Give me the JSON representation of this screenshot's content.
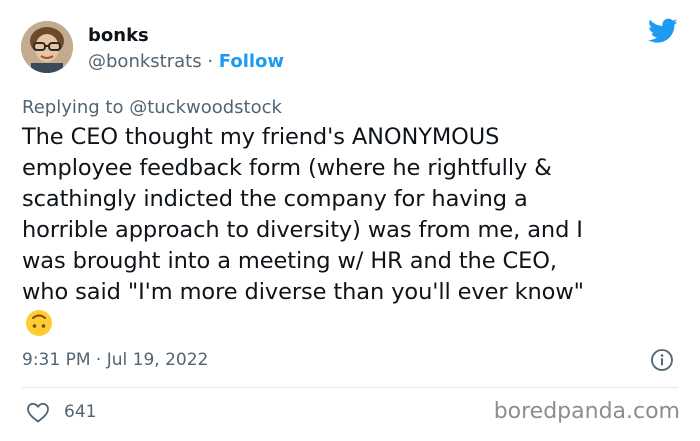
{
  "author": {
    "display_name": "bonks",
    "handle": "@bonkstrats",
    "separator": "·",
    "follow_label": "Follow"
  },
  "reply": {
    "prefix": "Replying to",
    "mention": "@tuckwoodstock"
  },
  "tweet": {
    "text": "The CEO thought my friend's ANONYMOUS\nemployee feedback form (where he rightfully &\nscathingly indicted the company for having a\nhorrible approach to diversity) was from me, and I\nwas brought into a meeting w/ HR and the CEO,\nwho said \"I'm more diverse than you'll ever know\"",
    "emoji": "upside-down-face-emoji"
  },
  "meta": {
    "timestamp": "9:31 PM · Jul 19, 2022"
  },
  "engagement": {
    "likes": "641"
  },
  "watermark": "boredpanda.com",
  "colors": {
    "accent": "#1d9bf0",
    "secondary_text": "#536471",
    "primary_text": "#0f1419"
  },
  "icons": {
    "brand": "twitter-bird-icon",
    "info": "info-icon",
    "like": "heart-icon"
  }
}
